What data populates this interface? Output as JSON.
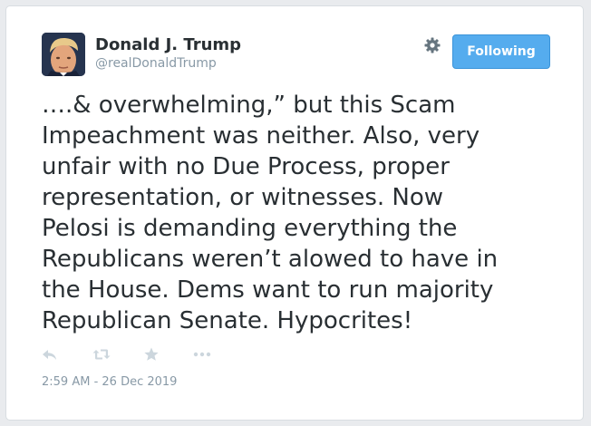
{
  "user": {
    "name": "Donald J. Trump",
    "handle": "@realDonaldTrump"
  },
  "follow_button": {
    "label": "Following"
  },
  "tweet": {
    "text": "….& overwhelming,” but this Scam\nImpeachment was neither. Also, very\nunfair with no Due Process, proper\nrepresentation, or witnesses. Now\nPelosi is demanding everything the\nRepublicans weren’t alowed to have in\nthe House. Dems want to run majority\nRepublican Senate. Hypocrites!",
    "timestamp": "2:59 AM - 26 Dec 2019"
  },
  "icons": {
    "settings": "gear-icon",
    "reply": "reply-icon",
    "retweet": "retweet-icon",
    "like": "star-icon",
    "more": "more-icon"
  },
  "colors": {
    "accent": "#55acee",
    "text": "#292f33",
    "muted": "#8899a6",
    "icon": "#ccd6dd"
  }
}
